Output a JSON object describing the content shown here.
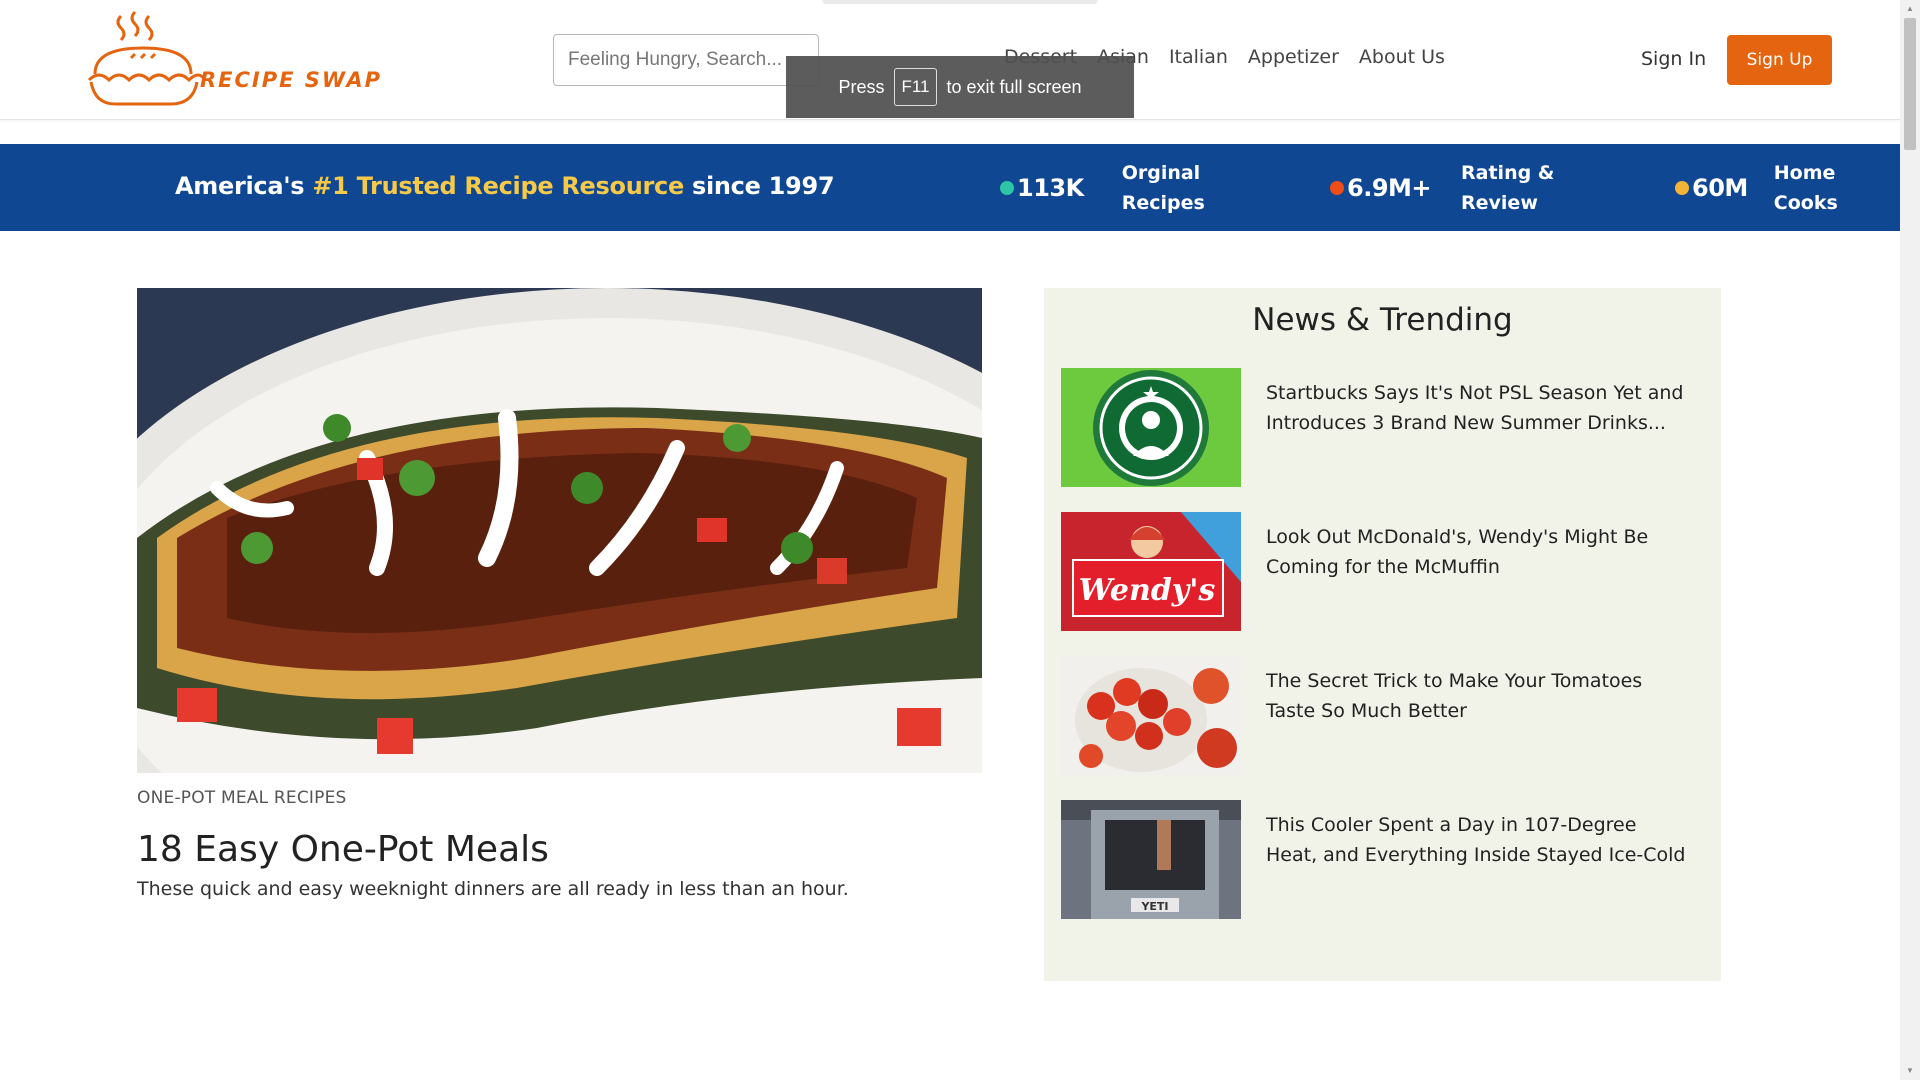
{
  "header": {
    "logo_text": "RECIPE SWAP",
    "search_placeholder": "Feeling Hungry, Search...",
    "nav": [
      "Dessert",
      "Asian",
      "Italian",
      "Appetizer",
      "About Us"
    ],
    "sign_in": "Sign In",
    "sign_up": "Sign Up"
  },
  "fullscreen_toast": {
    "press": "Press",
    "key": "F11",
    "message": "to exit full screen"
  },
  "banner": {
    "tagline_pre": "America's",
    "tagline_highlight": "#1 Trusted Recipe Resource",
    "tagline_post": "since 1997",
    "stats": [
      {
        "value": "113K",
        "label": "Orginal Recipes",
        "dot_color": "#2ec4a6"
      },
      {
        "value": "6.9M+",
        "label": "Rating & Review",
        "dot_color": "#f04d1a"
      },
      {
        "value": "60M",
        "label": "Home Cooks",
        "dot_color": "#f2b436"
      }
    ]
  },
  "feature": {
    "category": "ONE-POT MEAL RECIPES",
    "title": "18 Easy One-Pot Meals",
    "description": "These quick and easy weeknight dinners are all ready in less than an hour."
  },
  "news": {
    "title": "News & Trending",
    "items": [
      {
        "text": "Startbucks Says It's Not PSL Season Yet and Introduces 3 Brand New Summer Drinks..."
      },
      {
        "text": "Look Out McDonald's, Wendy's Might Be Coming for the McMuffin"
      },
      {
        "text": "The Secret Trick to Make Your Tomatoes Taste So Much Better"
      },
      {
        "text": "This Cooler Spent a Day in 107-Degree Heat, and Everything Inside Stayed Ice-Cold"
      }
    ]
  },
  "colors": {
    "brand_orange": "#e5640f",
    "banner_blue": "#0f4793",
    "highlight_yellow": "#f7c948",
    "news_bg": "#f2f3e8"
  }
}
